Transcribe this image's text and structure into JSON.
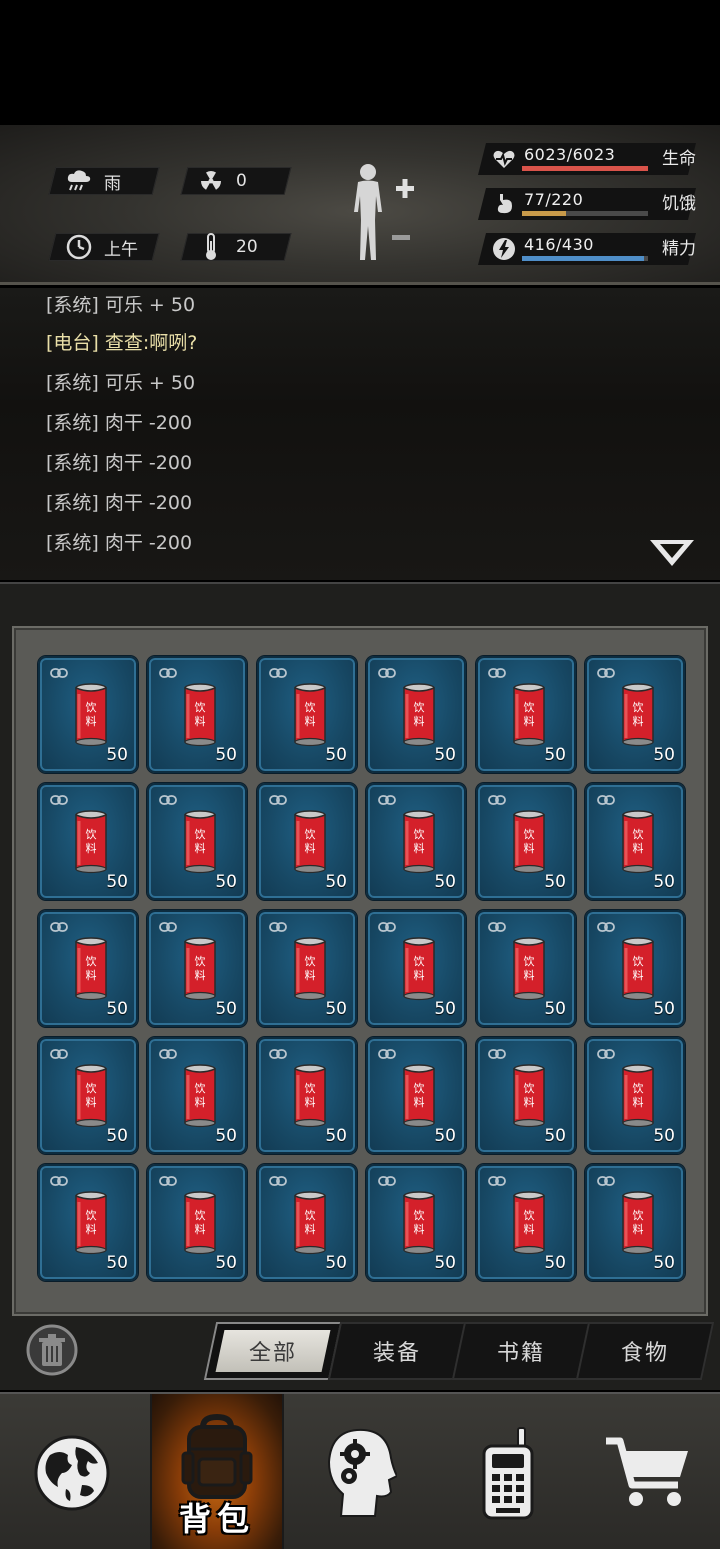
{
  "status": {
    "weather": "雨",
    "radiation": "0",
    "time_of_day": "上午",
    "temperature": "20"
  },
  "vitals": [
    {
      "label": "生命",
      "value": "6023/6023",
      "fraction": 1.0,
      "color": "#d9534a",
      "icon": "heart-pulse-icon"
    },
    {
      "label": "饥饿",
      "value": "77/220",
      "fraction": 0.35,
      "color": "#c89a4a",
      "icon": "stomach-icon"
    },
    {
      "label": "精力",
      "value": "416/430",
      "fraction": 0.967,
      "color": "#4f8ec8",
      "icon": "energy-bolt-icon"
    }
  ],
  "log": [
    {
      "tag": "[系统]",
      "msg": "可乐 + 50",
      "type": "system"
    },
    {
      "tag": "[电台]",
      "msg": "查查:啊咧?",
      "type": "radio"
    },
    {
      "tag": "[系统]",
      "msg": "可乐 + 50",
      "type": "system"
    },
    {
      "tag": "[系统]",
      "msg": "肉干 -200",
      "type": "system"
    },
    {
      "tag": "[系统]",
      "msg": "肉干 -200",
      "type": "system"
    },
    {
      "tag": "[系统]",
      "msg": "肉干 -200",
      "type": "system"
    },
    {
      "tag": "[系统]",
      "msg": "肉干 -200",
      "type": "system"
    }
  ],
  "inventory": {
    "rows": 5,
    "cols": 6,
    "item_icon": "cola-can-icon",
    "can_label": [
      "饮",
      "料"
    ],
    "quantity": "50"
  },
  "tabs": [
    {
      "label": "全部",
      "active": true
    },
    {
      "label": "装备",
      "active": false
    },
    {
      "label": "书籍",
      "active": false
    },
    {
      "label": "食物",
      "active": false
    }
  ],
  "nav": [
    {
      "icon": "globe-icon",
      "label": "",
      "active": false
    },
    {
      "icon": "backpack-icon",
      "label": "背包",
      "active": true
    },
    {
      "icon": "head-gears-icon",
      "label": "",
      "active": false
    },
    {
      "icon": "walkie-talkie-icon",
      "label": "",
      "active": false
    },
    {
      "icon": "shopping-cart-icon",
      "label": "",
      "active": false
    }
  ]
}
